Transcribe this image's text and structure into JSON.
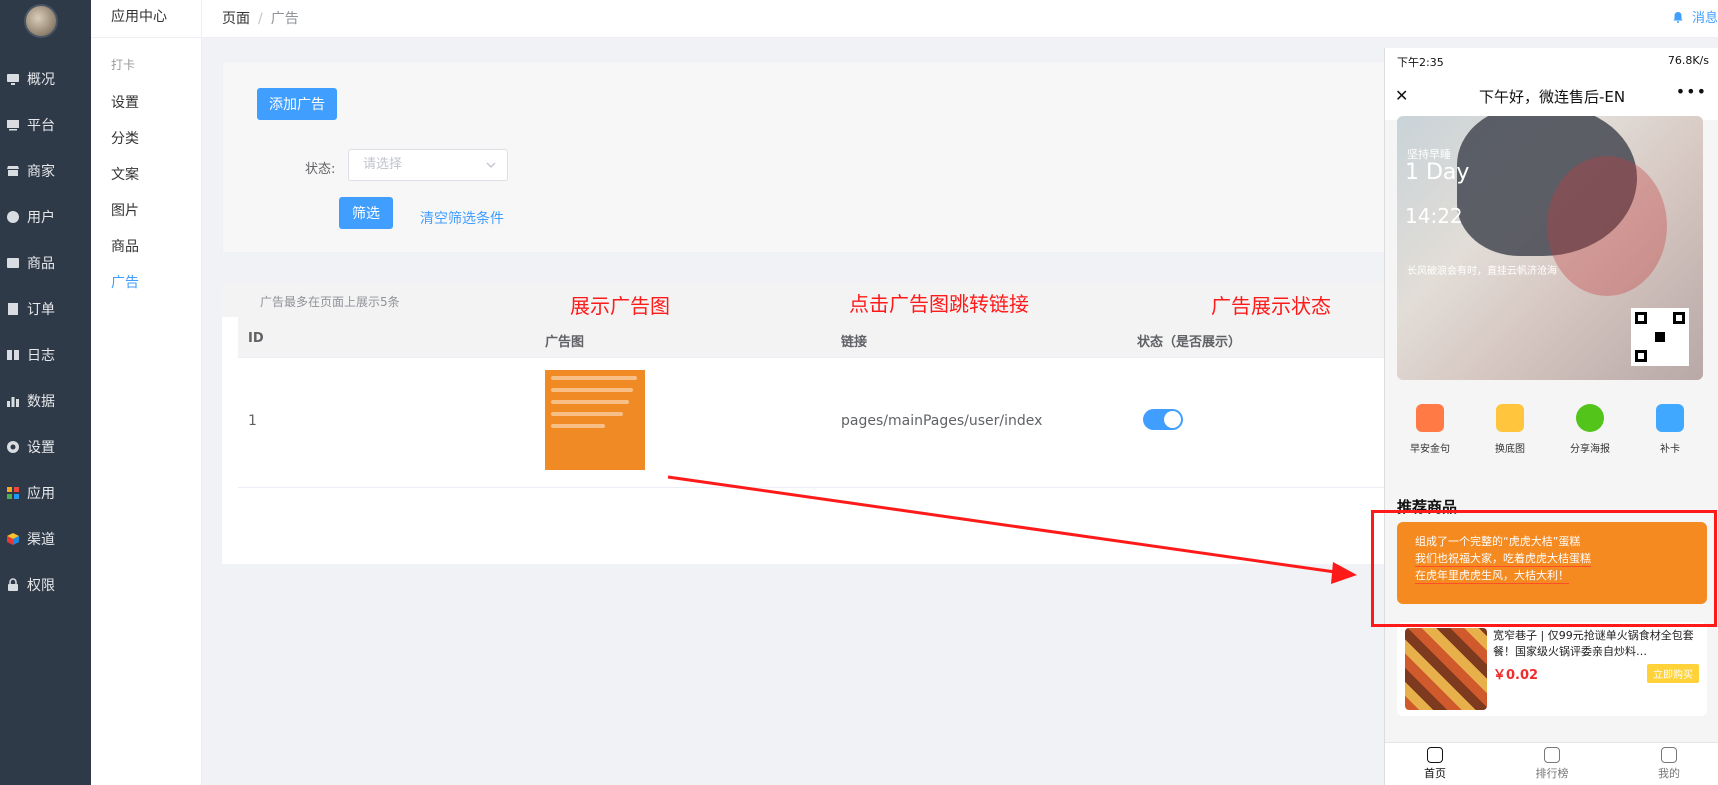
{
  "sidebar": {
    "items": [
      {
        "label": "概况",
        "icon": "monitor-icon"
      },
      {
        "label": "平台",
        "icon": "desktop-icon"
      },
      {
        "label": "商家",
        "icon": "store-icon"
      },
      {
        "label": "用户",
        "icon": "user-icon"
      },
      {
        "label": "商品",
        "icon": "box-icon"
      },
      {
        "label": "订单",
        "icon": "order-icon"
      },
      {
        "label": "日志",
        "icon": "log-icon"
      },
      {
        "label": "数据",
        "icon": "chart-icon"
      },
      {
        "label": "设置",
        "icon": "gear-icon"
      },
      {
        "label": "应用",
        "icon": "apps-icon"
      },
      {
        "label": "渠道",
        "icon": "cube-icon"
      },
      {
        "label": "权限",
        "icon": "lock-icon"
      }
    ]
  },
  "submenu": {
    "title": "应用中心",
    "group": "打卡",
    "items": [
      "设置",
      "分类",
      "文案",
      "图片",
      "商品",
      "广告"
    ],
    "active": "广告"
  },
  "header": {
    "breadcrumb_root": "页面",
    "breadcrumb_sep": "/",
    "breadcrumb_current": "广告",
    "message": "消息"
  },
  "filter": {
    "add_button": "添加广告",
    "status_label": "状态:",
    "status_placeholder": "请选择",
    "filter_button": "筛选",
    "clear_link": "清空筛选条件"
  },
  "table": {
    "note": "广告最多在页面上展示5条",
    "headers": {
      "id": "ID",
      "image": "广告图",
      "link": "链接",
      "status": "状态（是否展示）"
    },
    "rows": [
      {
        "id": "1",
        "link": "pages/mainPages/user/index",
        "enabled": true
      }
    ]
  },
  "annotations": {
    "image": "展示广告图",
    "link": "点击广告图跳转链接",
    "status": "广告展示状态"
  },
  "phone": {
    "time": "下午2:35",
    "status_right": "76.8K/s",
    "title": "下午好，微连售后-EN",
    "close": "✕",
    "more": "•••",
    "poster": {
      "tag": "坚持早睡",
      "day": "1 Day",
      "clock": "14:22",
      "quote": "长风破浪会有时，直挂云帆济沧海"
    },
    "icons": [
      "早安金句",
      "换底图",
      "分享海报",
      "补卡"
    ],
    "icon_colors": [
      "#ff7a45",
      "#ffc53d",
      "#52c41a",
      "#40a9ff"
    ],
    "section": "推荐商品",
    "ad_lines": [
      "组成了一个完整的“虎虎大桔”蛋糕",
      "我们也祝福大家，吃着虎虎大桔蛋糕",
      "在虎年里虎虎生风，大桔大利！"
    ],
    "product": {
      "name": "宽窄巷子 | 仅99元抢谜单火锅食材全包套餐！国家级火锅评委亲自炒料…",
      "price": "￥0.02",
      "buy": "立即购买"
    },
    "tabs": [
      "首页",
      "排行榜",
      "我的"
    ]
  }
}
